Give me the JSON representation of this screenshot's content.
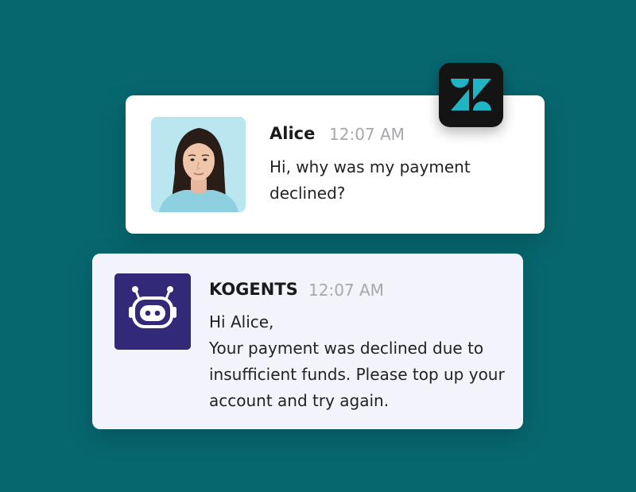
{
  "messages": {
    "user": {
      "name": "Alice",
      "time": "12:07 AM",
      "lines": [
        "Hi, why was my payment",
        "declined?"
      ],
      "avatar_icon": "user-photo-avatar"
    },
    "bot": {
      "name": "KOGENTS",
      "time": "12:07 AM",
      "lines": [
        "Hi Alice,",
        "Your payment was declined due to",
        "insufficient funds. Please top up your",
        "account and try again."
      ],
      "avatar_icon": "robot-icon"
    }
  },
  "badge": {
    "icon": "zendesk-logo-icon",
    "accent": "#1fb3c4"
  },
  "colors": {
    "background": "#07676f",
    "bot_avatar_bg": "#322a78",
    "user_avatar_bg": "#b9e6ef"
  }
}
